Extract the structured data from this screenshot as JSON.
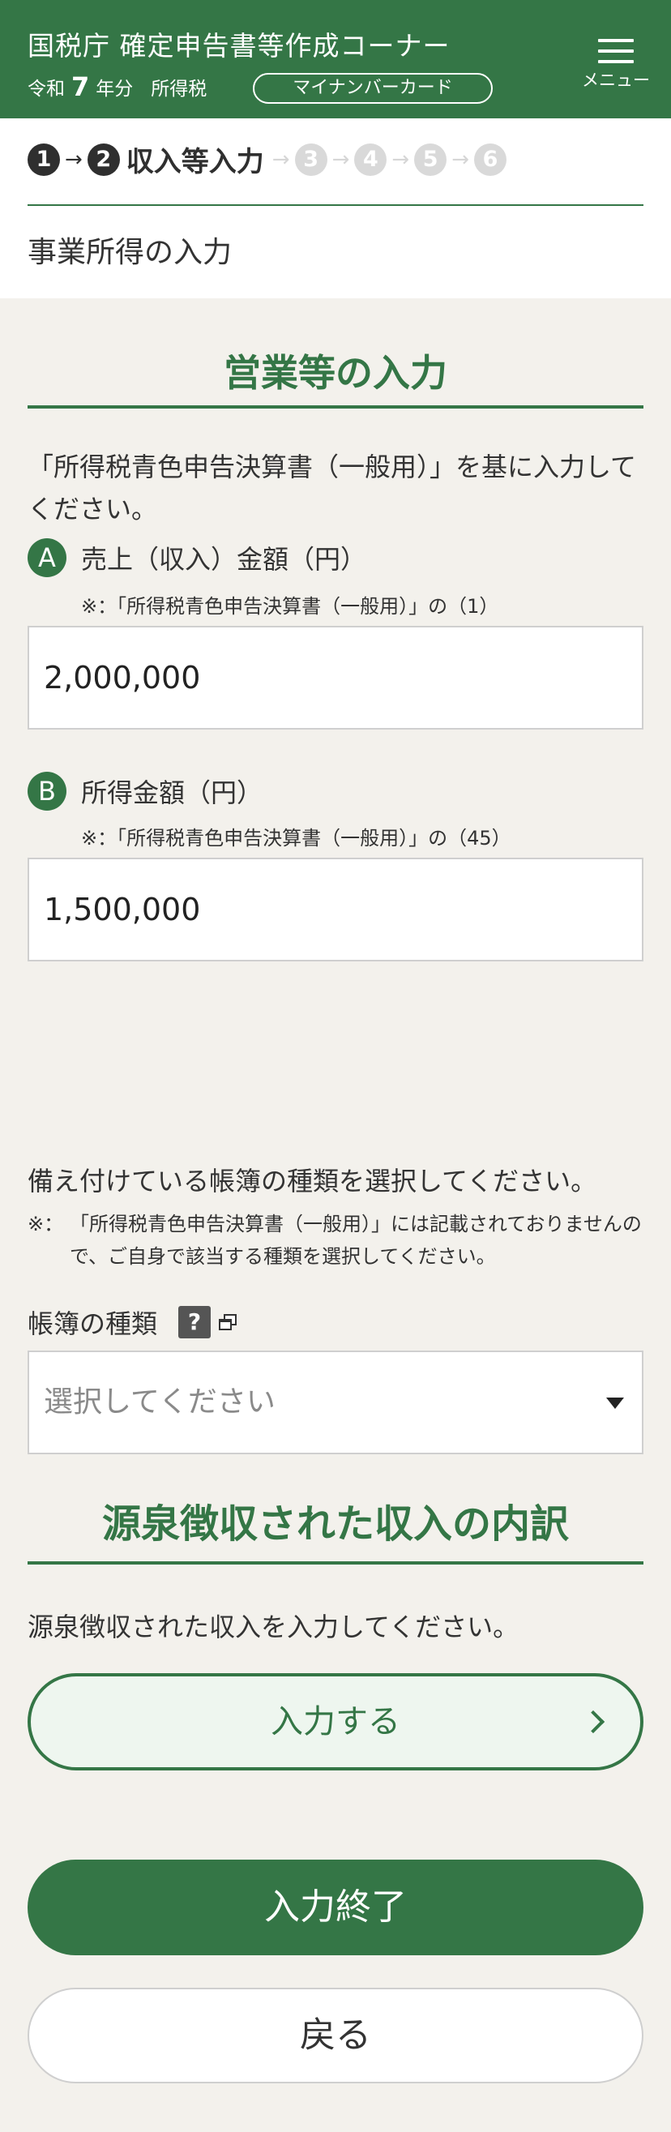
{
  "header": {
    "title": "国税庁 確定申告書等作成コーナー",
    "era": "令和",
    "year": "7",
    "year_suffix": "年分",
    "tax_type": "所得税",
    "mynumber_button": "マイナンバーカード",
    "menu_label": "メニュー"
  },
  "steps": {
    "items": [
      "1",
      "2",
      "3",
      "4",
      "5",
      "6"
    ],
    "current_label": "収入等入力"
  },
  "page": {
    "subtitle": "事業所得の入力"
  },
  "business_section": {
    "heading": "営業等の入力",
    "intro": "「所得税青色申告決算書（一般用）」を基に入力してください。",
    "field_a": {
      "badge": "A",
      "label": "売上（収入）金額（円）",
      "note": "※：「所得税青色申告決算書（一般用）」の（1）",
      "value": "2,000,000"
    },
    "field_b": {
      "badge": "B",
      "label": "所得金額（円）",
      "note": "※：「所得税青色申告決算書（一般用）」の（45）",
      "value": "1,500,000"
    }
  },
  "ledger": {
    "instruction": "備え付けている帳簿の種類を選択してください。",
    "note_mark": "※：",
    "note": "「所得税青色申告決算書（一般用）」には記載されておりませんので、ご自身で該当する種類を選択してください。",
    "label": "帳簿の種類",
    "help": "?",
    "select_placeholder": "選択してください"
  },
  "withholding": {
    "heading": "源泉徴収された収入の内訳",
    "text": "源泉徴収された収入を入力してください。",
    "enter_button": "入力する"
  },
  "actions": {
    "finish_button": "入力終了",
    "back_button": "戻る"
  },
  "colors": {
    "brand_green": "#347646",
    "background": "#f3f1ec",
    "enter_button_bg": "#eef6ef"
  }
}
